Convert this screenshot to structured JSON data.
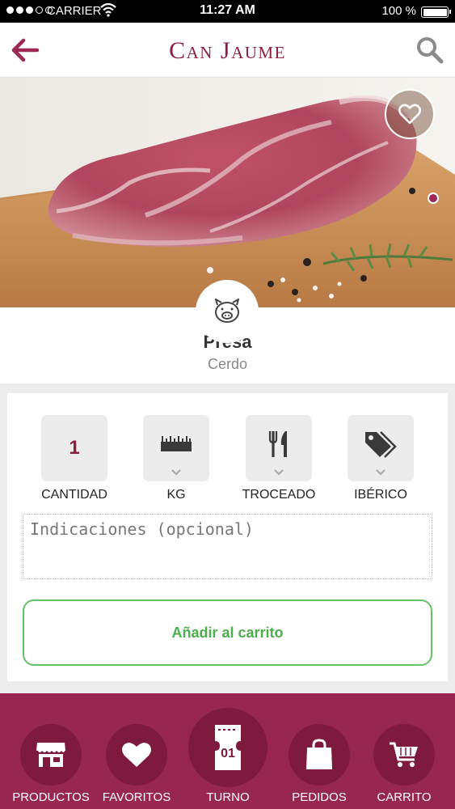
{
  "status_bar": {
    "carrier": "CARRIER",
    "time": "11:27 AM",
    "battery": "100 %"
  },
  "header": {
    "brand": "Can Jaume",
    "back_icon": "arrow-left-icon",
    "search_icon": "search-icon"
  },
  "product": {
    "name": "Presa",
    "category": "Cerdo",
    "favorite_icon": "heart-outline-icon",
    "category_icon": "pig-icon"
  },
  "options": {
    "cantidad": {
      "value": "1",
      "label": "CANTIDAD"
    },
    "kg": {
      "label": "KG",
      "icon": "ruler-icon"
    },
    "troceado": {
      "label": "TROCEADO",
      "icon": "fork-knife-icon"
    },
    "iberico": {
      "label": "IBÉRICO",
      "icon": "tag-icon"
    }
  },
  "notes": {
    "placeholder": "Indicaciones (opcional)"
  },
  "add_button": {
    "label": "Añadir al carrito"
  },
  "tabbar": {
    "tabs": [
      {
        "label": "PRODUCTOS",
        "icon": "store-icon"
      },
      {
        "label": "FAVORITOS",
        "icon": "heart-icon"
      },
      {
        "label": "TURNO",
        "icon": "ticket-icon",
        "number": "01"
      },
      {
        "label": "PEDIDOS",
        "icon": "shopping-bag-icon"
      },
      {
        "label": "CARRITO",
        "icon": "cart-icon"
      }
    ]
  },
  "colors": {
    "brand": "#8c1f3e",
    "tabbar": "#98274f",
    "tab_circle": "#7d1a3d",
    "add_button": "#4cae4c"
  }
}
